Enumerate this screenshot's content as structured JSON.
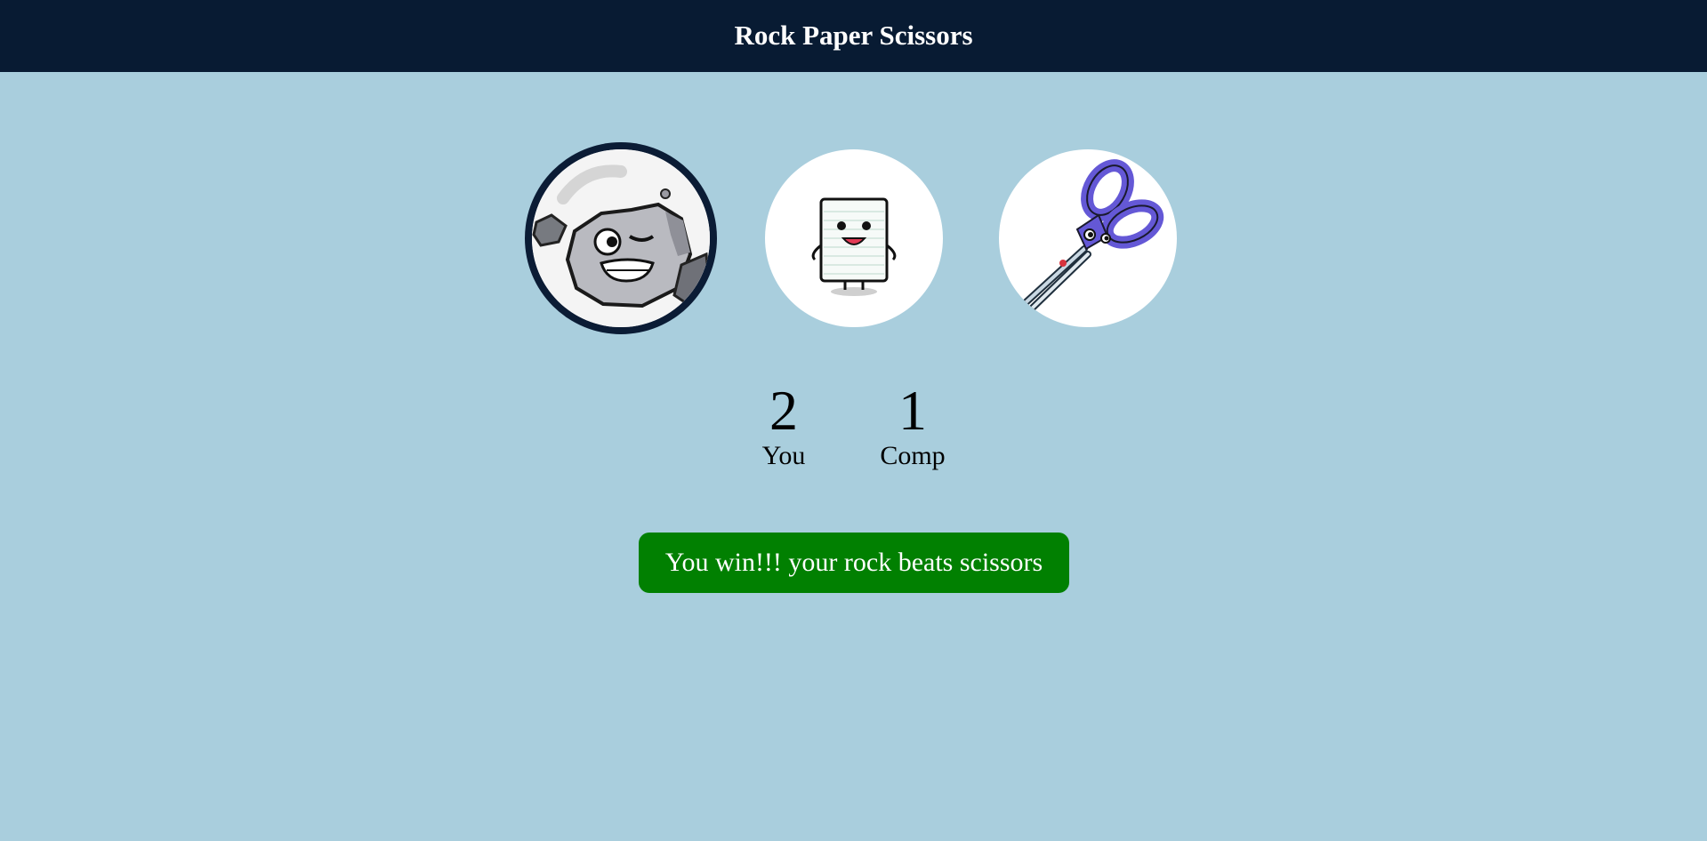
{
  "header": {
    "title": "Rock Paper Scissors"
  },
  "choices": [
    {
      "id": "rock",
      "icon": "rock-character-icon",
      "selected": true
    },
    {
      "id": "paper",
      "icon": "paper-character-icon",
      "selected": false
    },
    {
      "id": "scissors",
      "icon": "scissors-icon",
      "selected": false
    }
  ],
  "scoreboard": {
    "user": {
      "score": "2",
      "label": "You"
    },
    "comp": {
      "score": "1",
      "label": "Comp"
    }
  },
  "message": {
    "text": "You win!!! your rock beats scissors"
  },
  "colors": {
    "header_bg": "#081b33",
    "page_bg": "#a9cedd",
    "win_bg": "#018001",
    "selected_ring": "#0b1c35"
  }
}
